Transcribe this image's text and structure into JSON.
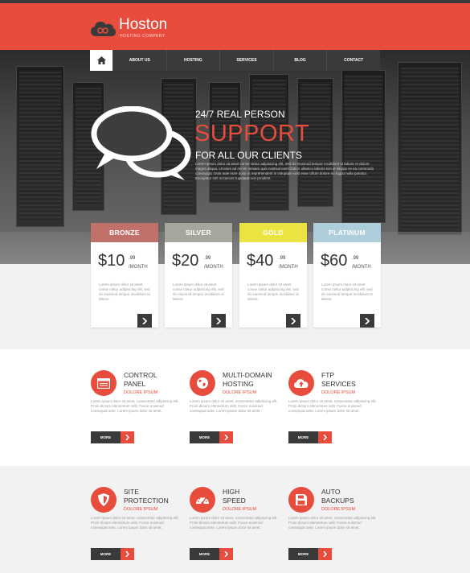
{
  "brand": {
    "name": "Hoston",
    "tagline": "HOSTING COMPANY"
  },
  "colors": {
    "accent": "#e74c3c",
    "dark": "#3a3a3a",
    "bronze": "#c0716a",
    "silver": "#a3a79c",
    "gold": "#e9e441",
    "platinum": "#aecedb"
  },
  "nav": {
    "home_icon": "home-icon",
    "items": [
      "ABOUT US",
      "HOSTING",
      "SERVICES",
      "BLOG",
      "CONTACT"
    ]
  },
  "hero": {
    "line1": "24/7 REAL PERSON",
    "line2": "SUPPORT",
    "line3": "FOR ALL OUR CLIENTS",
    "lorem": "Lorem ipsum dolor sit amet conse ctetur adipisicing elit, sed do eiusmod tempor incididunt ut labore et dolore magna aliqua. Ut enim ad minim veniam quis nostrud exercitation ullamco laboris nisi ut aliquip ex ea commodo consequat. Duis aute irure dolor in reprehenderit in voluptate velit esse cillum dolore eu fugiat nulla pariatur. Excepteur sint occaecat cupidatat non proident."
  },
  "plans": [
    {
      "name": "BRONZE",
      "price": "$10",
      "cents": ".99",
      "period": "/MONTH",
      "lorem": "Lorem ipsum dolor sit amet conse ctetur adipisicing elit, sed do eiusmod tempor incididunt ut labore."
    },
    {
      "name": "SILVER",
      "price": "$20",
      "cents": ".99",
      "period": "/MONTH",
      "lorem": "Lorem ipsum dolor sit amet conse ctetur adipisicing elit, sed do eiusmod tempor incididunt ut labore."
    },
    {
      "name": "GOLD",
      "price": "$40",
      "cents": ".99",
      "period": "/MONTH",
      "lorem": "Lorem ipsum dolor sit amet conse ctetur adipisicing elit, sed do eiusmod tempor incididunt ut labore."
    },
    {
      "name": "PLATINUM",
      "price": "$60",
      "cents": ".99",
      "period": "/MONTH",
      "lorem": "Lorem ipsum dolor sit amet conse ctetur adipisicing elit, sed do eiusmod tempor incididunt ut labore."
    }
  ],
  "features": [
    {
      "title1": "CONTROL",
      "title2": "PANEL",
      "sub": "DOLORE IPSUM",
      "icon": "browser-window-icon",
      "lorem": "Lorem ipsum dolor sit amet, consectetur adipiscing elit. Proin dictum elementum velit. Fusce euismod consequat ante. Lorem ipsum dolor sit amet.",
      "more": "MORE"
    },
    {
      "title1": "MULTI-DOMAIN",
      "title2": "HOSTING",
      "sub": "DOLORE IPSUM",
      "icon": "globe-icon",
      "lorem": "Lorem ipsum dolor sit amet, consectetur adipiscing elit. Proin dictum elementum velit. Fusce euismod consequat ante. Lorem ipsum dolor sit amet.",
      "more": "MORE"
    },
    {
      "title1": "FTP",
      "title2": "SERVICES",
      "sub": "DOLORE IPSUM",
      "icon": "cloud-upload-icon",
      "lorem": "Lorem ipsum dolor sit amet, consectetur adipiscing elit. Proin dictum elementum velit. Fusce euismod consequat ante. Lorem ipsum dolor sit amet.",
      "more": "MORE"
    },
    {
      "title1": "SITE",
      "title2": "PROTECTION",
      "sub": "DOLORE IPSUM",
      "icon": "shield-icon",
      "lorem": "Lorem ipsum dolor sit amet, consectetur adipiscing elit. Proin dictum elementum velit. Fusce euismod consequat ante. Lorem ipsum dolor sit amet.",
      "more": "MORE"
    },
    {
      "title1": "HIGH",
      "title2": "SPEED",
      "sub": "DOLORE IPSUM",
      "icon": "speedometer-icon",
      "lorem": "Lorem ipsum dolor sit amet, consectetur adipiscing elit. Proin dictum elementum velit. Fusce euismod consequat ante. Lorem ipsum dolor sit amet.",
      "more": "MORE"
    },
    {
      "title1": "AUTO",
      "title2": "BACKUPS",
      "sub": "DOLORE IPSUM",
      "icon": "floppy-disk-icon",
      "lorem": "Lorem ipsum dolor sit amet, consectetur adipiscing elit. Proin dictum elementum velit. Fusce euismod consequat ante. Lorem ipsum dolor sit amet.",
      "more": "MORE"
    }
  ]
}
